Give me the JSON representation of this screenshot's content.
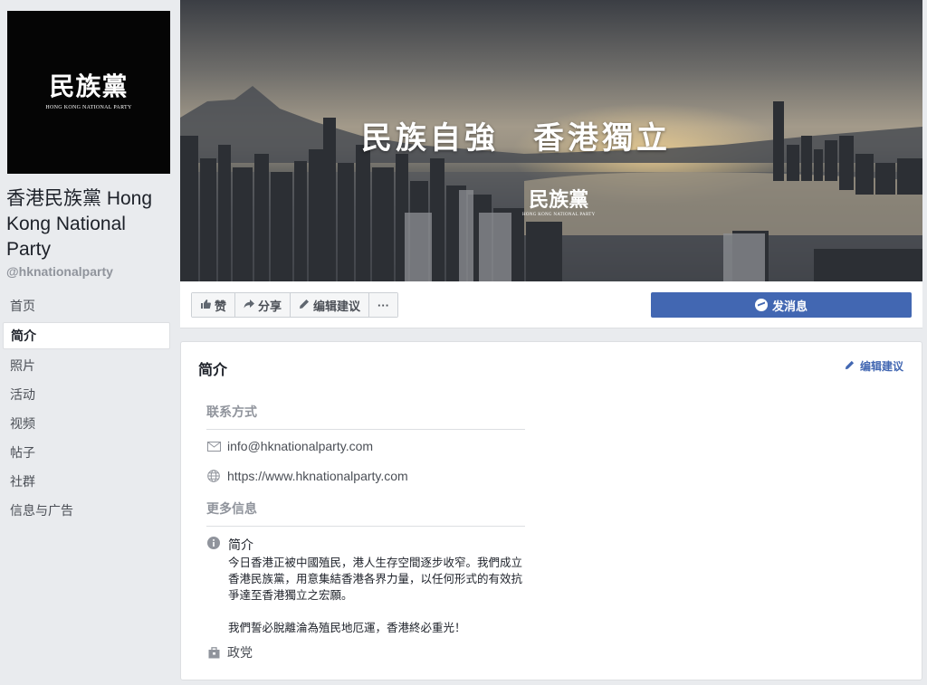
{
  "profile": {
    "logo_cn": "民族黨",
    "logo_en": "HONG KONG NATIONAL PARTY",
    "name": "香港民族黨 Hong Kong National Party",
    "handle": "@hknationalparty"
  },
  "nav": {
    "items": [
      {
        "label": "首页"
      },
      {
        "label": "简介"
      },
      {
        "label": "照片"
      },
      {
        "label": "活动"
      },
      {
        "label": "视频"
      },
      {
        "label": "帖子"
      },
      {
        "label": "社群"
      },
      {
        "label": "信息与广告"
      }
    ],
    "active_index": 1
  },
  "cover": {
    "slogan": "民族自強　香港獨立",
    "logo_cn": "民族黨",
    "logo_en": "HONG KONG NATIONAL PARTY"
  },
  "actions": {
    "like": "赞",
    "share": "分享",
    "suggest_edit": "编辑建议",
    "more": "···",
    "message": "发消息"
  },
  "about": {
    "title": "简介",
    "edit_link": "编辑建议",
    "contact_heading": "联系方式",
    "email": "info@hknationalparty.com",
    "website": "https://www.hknationalparty.com",
    "more_heading": "更多信息",
    "intro_label": "简介",
    "intro_p1": "今日香港正被中國殖民，港人生存空間逐步收窄。我們成立香港民族黨，用意集結香港各界力量，以任何形式的有效抗爭達至香港獨立之宏願。",
    "intro_p2": "我們誓必脫離淪為殖民地厄運，香港終必重光！",
    "category": "政党"
  },
  "colors": {
    "page_bg": "#e9ebee",
    "brand_blue": "#4267b2",
    "muted_text": "#90949c"
  }
}
